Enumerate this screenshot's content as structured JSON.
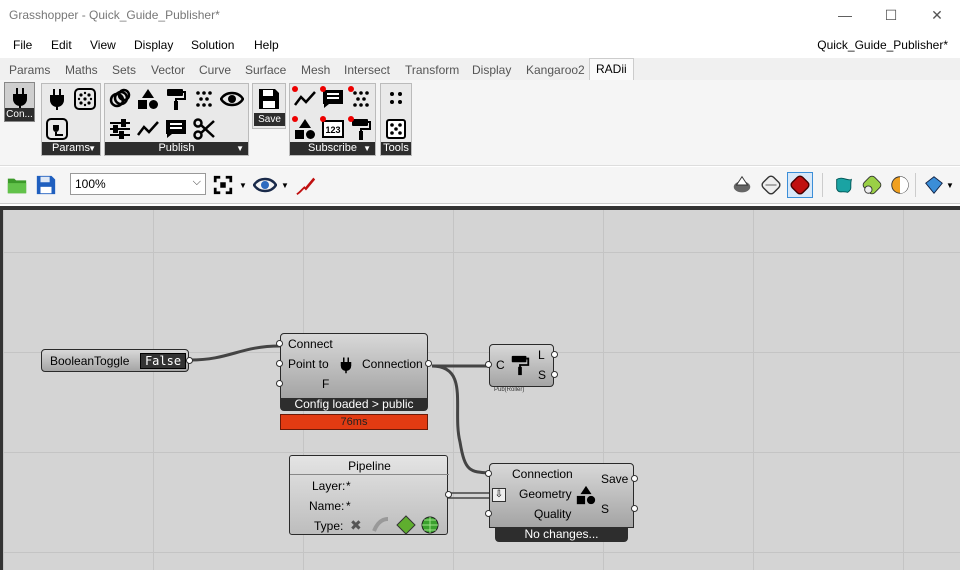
{
  "window": {
    "title": "Grasshopper - Quick_Guide_Publisher*",
    "minimize": "—",
    "maximize": "☐",
    "close": "✕"
  },
  "menu": {
    "items": [
      "File",
      "Edit",
      "View",
      "Display",
      "Solution",
      "Help"
    ],
    "doc_name": "Quick_Guide_Publisher*"
  },
  "tabs": [
    "Params",
    "Maths",
    "Sets",
    "Vector",
    "Curve",
    "Surface",
    "Mesh",
    "Intersect",
    "Transform",
    "Display",
    "Kangaroo2",
    "RADii"
  ],
  "active_tab": "RADii",
  "ribbon": {
    "selected_tile_label": "Con...",
    "panels": {
      "params": "Params",
      "publish": "Publish",
      "save": "Save",
      "subscribe": "Subscribe",
      "tools": "Tools"
    },
    "icons": {
      "connect": "plug-icon",
      "point_cloud": "point-cloud-icon",
      "plug_alt": "plug-cable-icon",
      "layers": "layers-icon",
      "shapes": "shapes-icon",
      "paint_roller": "paint-roller-icon",
      "scatter": "scatter-icon",
      "eye": "eye-icon",
      "sliders": "sliders-icon",
      "polyline": "polyline-icon",
      "comment": "comment-icon",
      "scissors": "scissors-icon",
      "save": "floppy-disk-icon",
      "number_block": "number-block-icon"
    },
    "number_icon_text": "123"
  },
  "toolbar": {
    "zoom": "100%"
  },
  "nodes": {
    "toggle": {
      "label": "BooleanToggle",
      "value": "False"
    },
    "connect": {
      "inputs": [
        "Connect",
        "Point to",
        "F"
      ],
      "output": "Connection",
      "status": "Config loaded > public",
      "timing": "76ms"
    },
    "roller": {
      "input": "C",
      "outputs": [
        "L",
        "S"
      ],
      "caption": "Pub(Roller)"
    },
    "pipeline": {
      "title": "Pipeline",
      "rows": [
        {
          "label": "Layer:",
          "value": "*"
        },
        {
          "label": "Name:",
          "value": "*"
        },
        {
          "label": "Type:",
          "value": ""
        }
      ]
    },
    "publisher": {
      "inputs": [
        "Connection",
        "Geometry",
        "Quality"
      ],
      "outputs": [
        "Save",
        "S"
      ],
      "status": "No changes..."
    }
  },
  "colors": {
    "status_red": "#e23b12",
    "node_border": "#2a2a2a",
    "canvas_bg": "#d4d4d4"
  }
}
